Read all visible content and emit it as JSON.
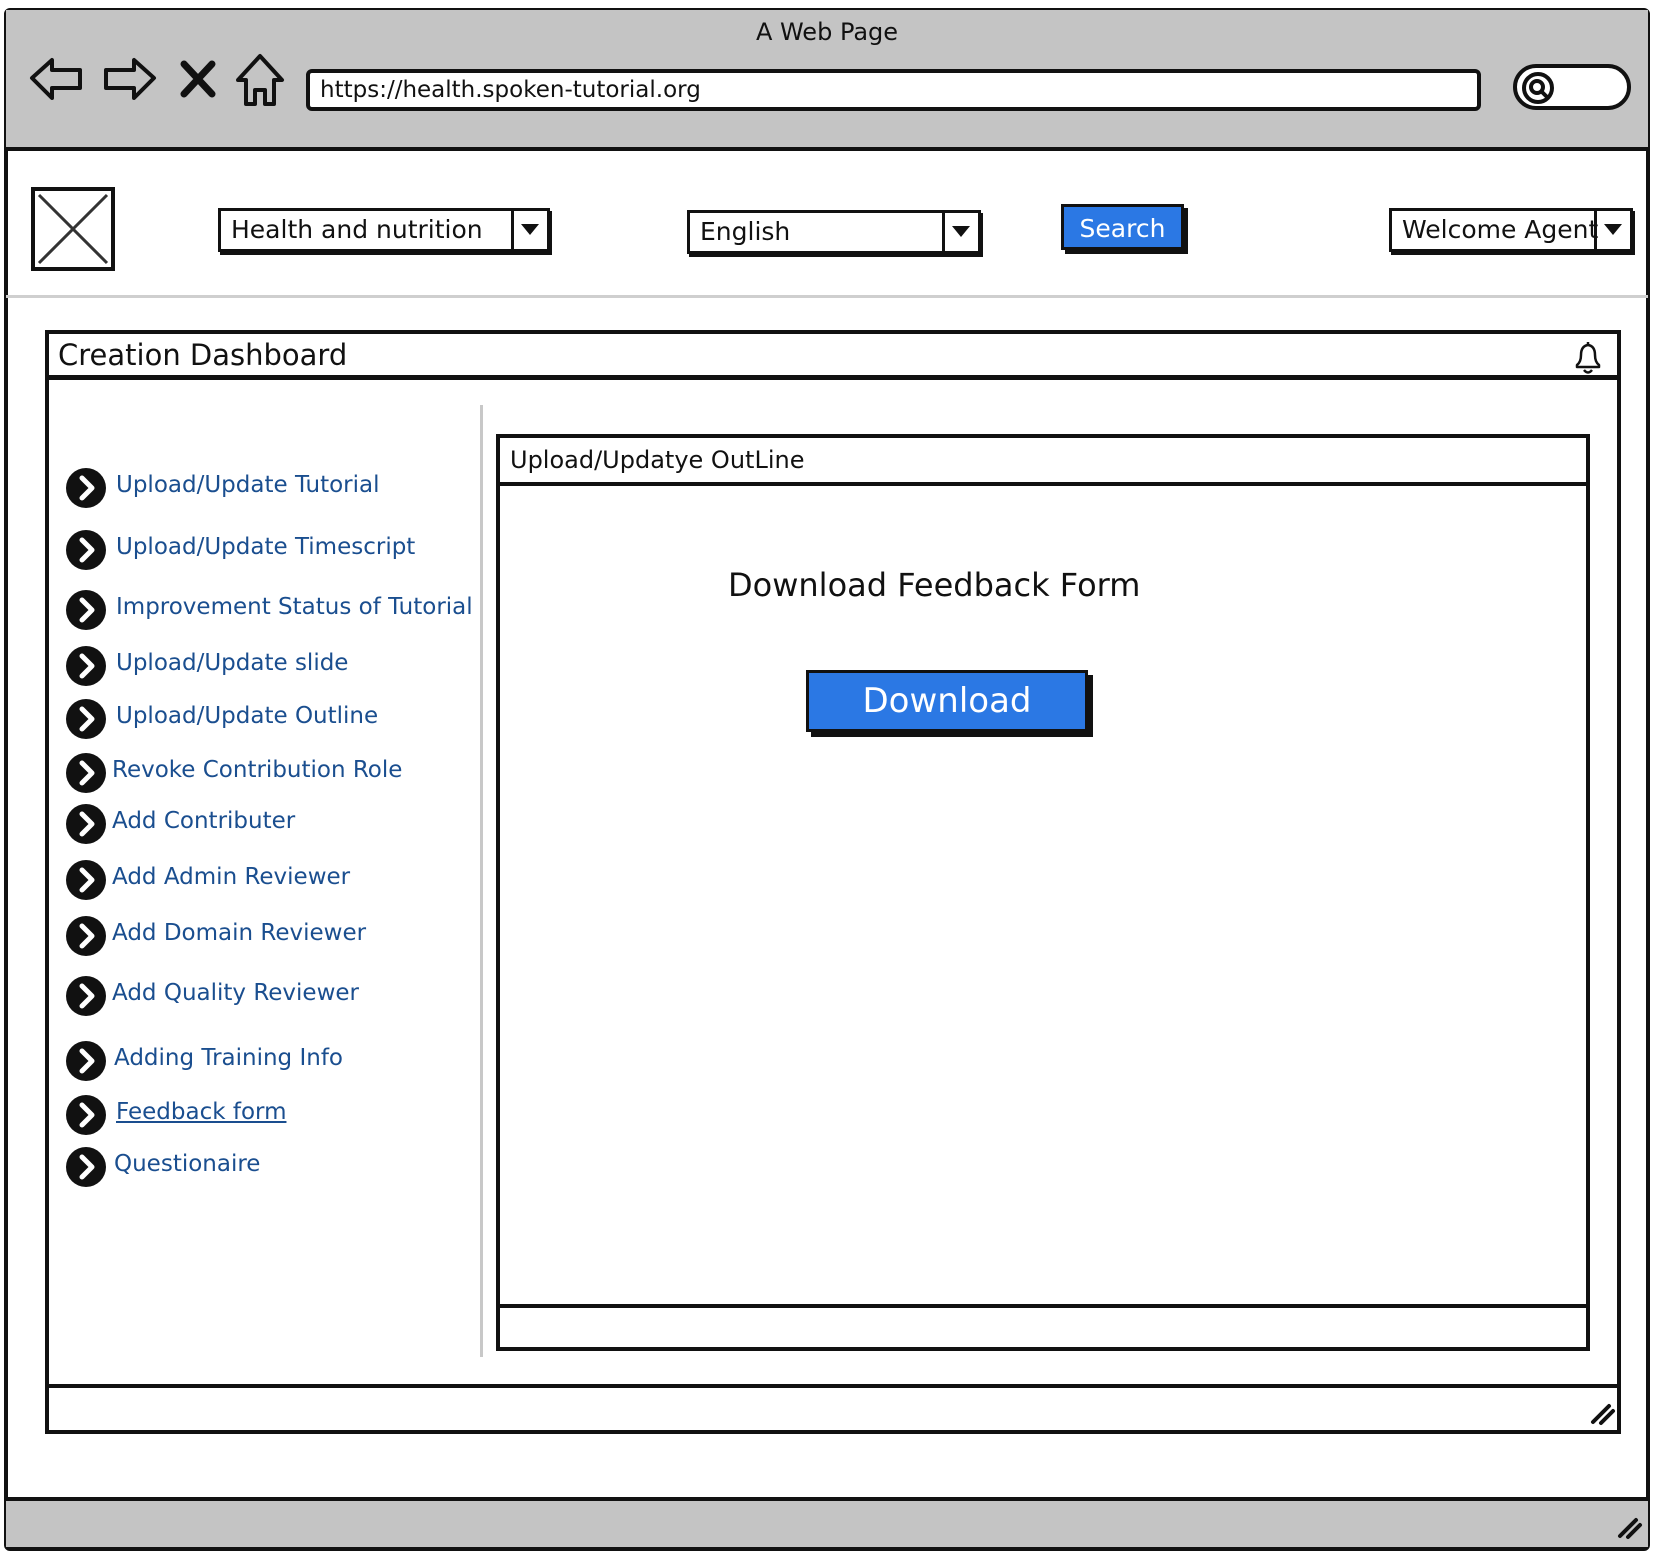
{
  "browser": {
    "window_title": "A Web Page",
    "url": "https://health.spoken-tutorial.org",
    "nav_icons": [
      "back-arrow-icon",
      "forward-arrow-icon",
      "close-x-icon",
      "home-icon"
    ],
    "search_icon": "search-icon"
  },
  "header": {
    "logo_icon": "image-placeholder-icon",
    "category_select": "Health and nutrition",
    "language_select": "English",
    "search_button": "Search",
    "user_menu": "Welcome Agent"
  },
  "dashboard": {
    "title": "Creation Dashboard",
    "notification_icon": "bell-icon",
    "menu": [
      {
        "label": "Upload/Update Tutorial",
        "icon": "chevron-right-circle-icon"
      },
      {
        "label": "Upload/Update Timescript",
        "icon": "chevron-right-circle-icon"
      },
      {
        "label": "Improvement Status of Tutorial",
        "icon": "chevron-right-circle-icon"
      },
      {
        "label": "Upload/Update slide",
        "icon": "chevron-right-circle-icon"
      },
      {
        "label": "Upload/Update Outline",
        "icon": "chevron-right-circle-icon"
      },
      {
        "label": "Revoke Contribution Role",
        "icon": "chevron-right-circle-icon"
      },
      {
        "label": "Add Contributer",
        "icon": "chevron-right-circle-icon"
      },
      {
        "label": "Add Admin Reviewer",
        "icon": "chevron-right-circle-icon"
      },
      {
        "label": "Add Domain Reviewer",
        "icon": "chevron-right-circle-icon"
      },
      {
        "label": "Add Quality Reviewer",
        "icon": "chevron-right-circle-icon"
      },
      {
        "label": "Adding Training Info",
        "icon": "chevron-right-circle-icon"
      },
      {
        "label": "Feedback form",
        "icon": "chevron-right-circle-icon",
        "underlined": true
      },
      {
        "label": "Questionaire",
        "icon": "chevron-right-circle-icon"
      }
    ],
    "panel": {
      "title": "Upload/Updatye OutLine",
      "heading": "Download Feedback Form",
      "download_button": "Download"
    }
  },
  "colors": {
    "chrome_gray": "#c4c4c4",
    "accent_blue": "#2b78e4",
    "link_blue": "#1a4e8f",
    "outline": "#111111"
  }
}
